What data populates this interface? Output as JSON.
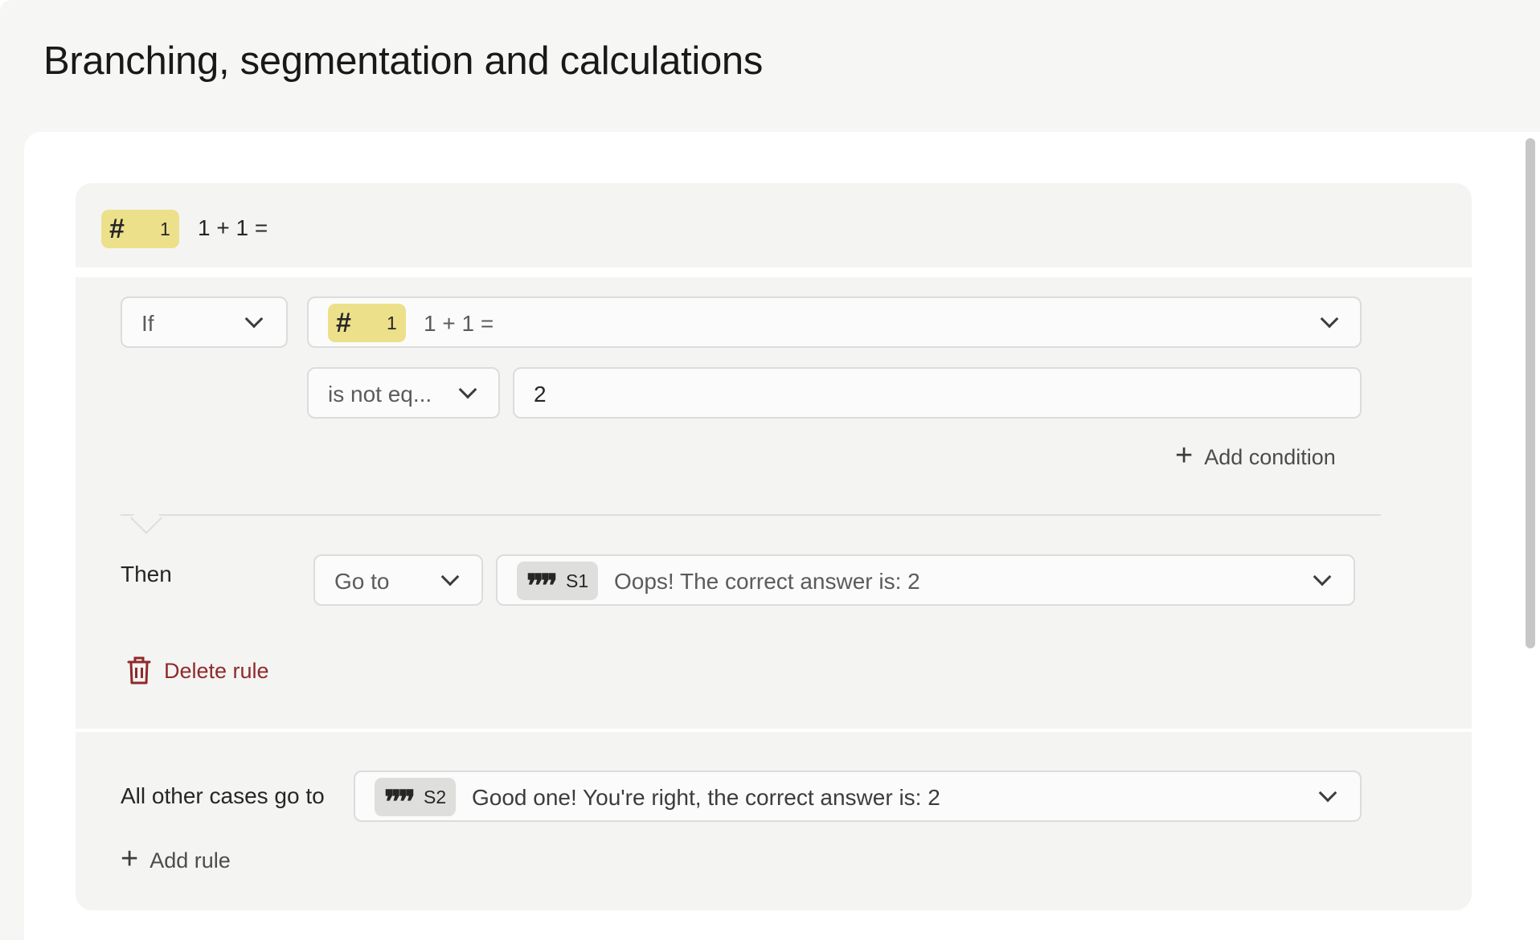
{
  "page": {
    "title": "Branching, segmentation and calculations"
  },
  "question": {
    "badge_icon": "hash-icon",
    "badge_number": "1",
    "text": "1 + 1 ="
  },
  "rule": {
    "if_select": "If",
    "condition_question": {
      "badge_number": "1",
      "text": "1 + 1 ="
    },
    "operator": "is not eq...",
    "value": "2",
    "add_condition_label": "Add condition",
    "then_label": "Then",
    "action_select": "Go to",
    "target": {
      "badge_icon": "quote-icon",
      "badge_label": "S1",
      "text": "Oops! The correct answer is: 2"
    },
    "delete_label": "Delete rule"
  },
  "default": {
    "label": "All other cases go to",
    "target": {
      "badge_icon": "quote-icon",
      "badge_label": "S2",
      "text": "Good one! You're right, the correct answer is: 2"
    },
    "add_rule_label": "Add rule"
  },
  "colors": {
    "question_badge": "#ede08a",
    "statement_badge": "#dededc",
    "delete": "#8f2a2a",
    "card": "#f4f4f3"
  }
}
